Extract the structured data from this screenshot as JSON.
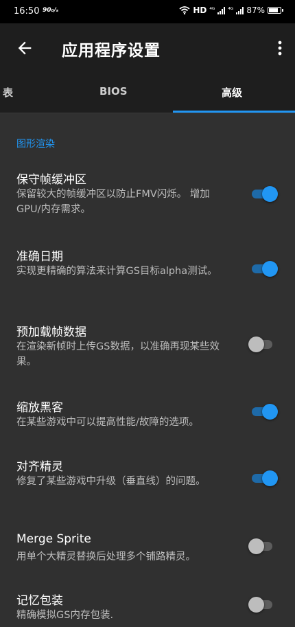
{
  "status": {
    "time": "16:50",
    "speed": "90₀/ₛ",
    "hd": "HD",
    "sig1": "⁴ᴳ",
    "sig2": "⁴ᴳ",
    "battery": "87%",
    "battery_level": 0.87
  },
  "appbar": {
    "title": "应用程序设置"
  },
  "tabs": [
    {
      "label": "表"
    },
    {
      "label": "BIOS"
    },
    {
      "label": "高级"
    }
  ],
  "section": {
    "title": "图形渲染"
  },
  "settings": [
    {
      "title": "保守帧缓冲区",
      "summary": "保留较大的帧缓冲区以防止FMV闪烁。 增加GPU/内存需求。",
      "enabled": true
    },
    {
      "title": "准确日期",
      "summary": "实现更精确的算法来计算GS目标alpha测试。",
      "enabled": true
    },
    {
      "title": "预加载帧数据",
      "summary": "在渲染新帧时上传GS数据，以准确再现某些效果。",
      "enabled": false
    },
    {
      "title": "缩放黑客",
      "summary": "在某些游戏中可以提高性能/故障的选项。",
      "enabled": true
    },
    {
      "title": "对齐精灵",
      "summary": "修复了某些游戏中升级（垂直线）的问题。",
      "enabled": true
    },
    {
      "title": "Merge Sprite",
      "summary": "用单个大精灵替换后处理多个铺路精灵。",
      "enabled": false
    },
    {
      "title": "记忆包装",
      "summary": "精确模拟GS内存包装.",
      "enabled": false
    }
  ]
}
